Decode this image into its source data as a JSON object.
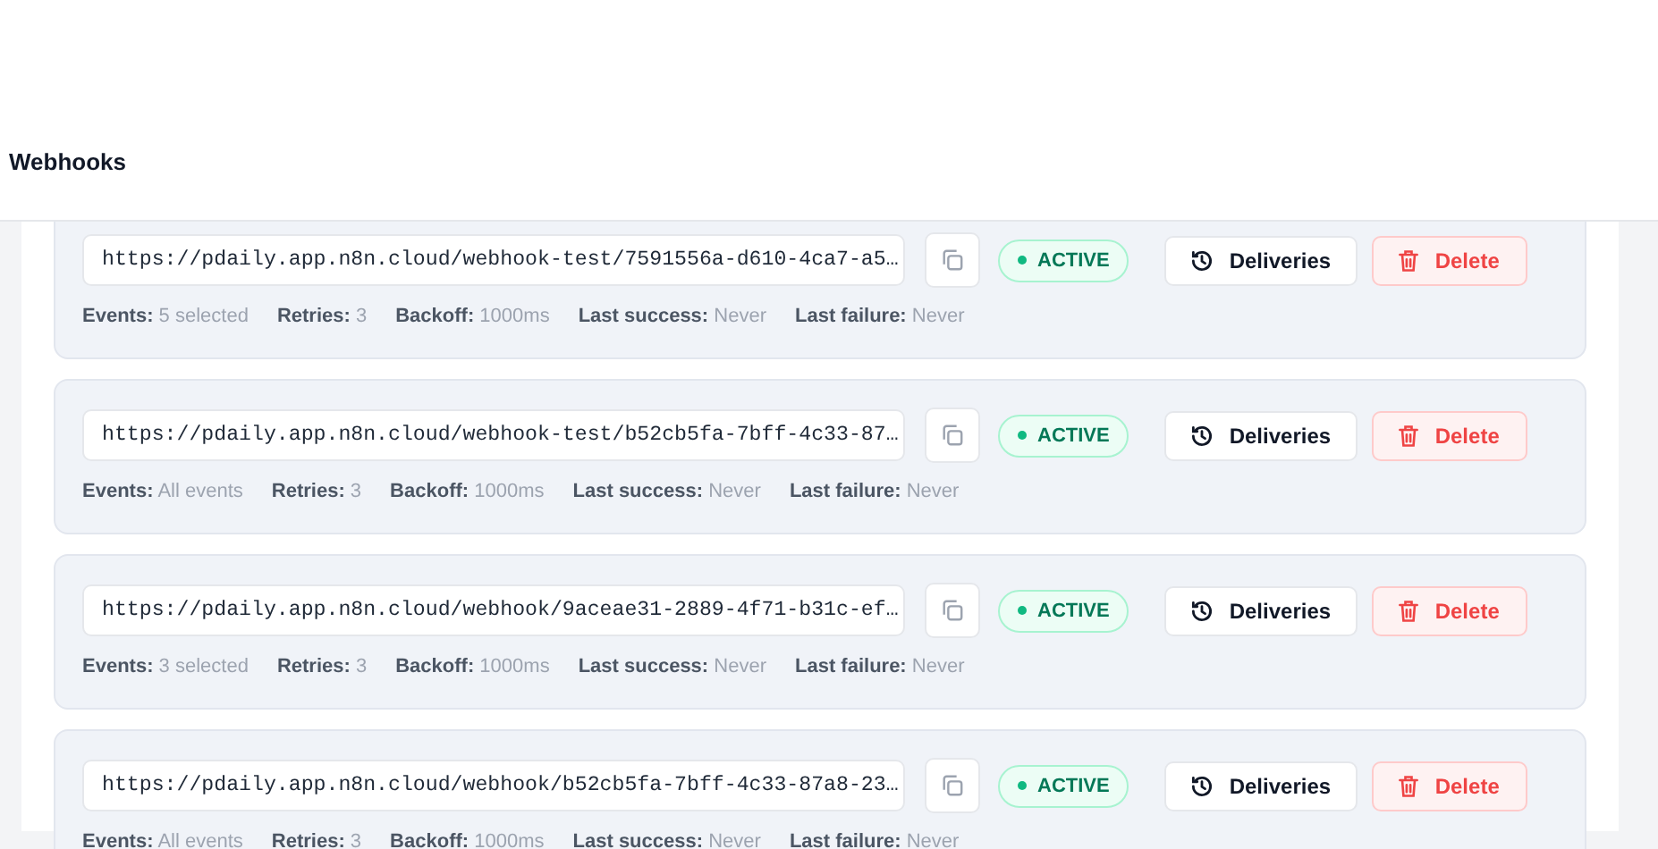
{
  "page_title": "Webhooks",
  "webhooks": [
    {
      "url": "https://pdaily.app.n8n.cloud/webhook-test/7591556a-d610-4ca7-a5…",
      "status": "ACTIVE",
      "actions": [
        "Deliveries",
        "Delete"
      ],
      "meta": [
        {
          "label": "Events:",
          "value": "5 selected"
        },
        {
          "label": "Retries:",
          "value": "3"
        },
        {
          "label": "Backoff:",
          "value": "1000ms"
        },
        {
          "label": "Last success:",
          "value": "Never"
        },
        {
          "label": "Last failure:",
          "value": "Never"
        }
      ]
    },
    {
      "url": "https://pdaily.app.n8n.cloud/webhook-test/b52cb5fa-7bff-4c33-87…",
      "status": "ACTIVE",
      "actions": [
        "Deliveries",
        "Delete"
      ],
      "meta": [
        {
          "label": "Events:",
          "value": "All events"
        },
        {
          "label": "Retries:",
          "value": "3"
        },
        {
          "label": "Backoff:",
          "value": "1000ms"
        },
        {
          "label": "Last success:",
          "value": "Never"
        },
        {
          "label": "Last failure:",
          "value": "Never"
        }
      ]
    },
    {
      "url": "https://pdaily.app.n8n.cloud/webhook/9aceae31-2889-4f71-b31c-ef…",
      "status": "ACTIVE",
      "actions": [
        "Deliveries",
        "Delete"
      ],
      "meta": [
        {
          "label": "Events:",
          "value": "3 selected"
        },
        {
          "label": "Retries:",
          "value": "3"
        },
        {
          "label": "Backoff:",
          "value": "1000ms"
        },
        {
          "label": "Last success:",
          "value": "Never"
        },
        {
          "label": "Last failure:",
          "value": "Never"
        }
      ]
    },
    {
      "url": "https://pdaily.app.n8n.cloud/webhook/b52cb5fa-7bff-4c33-87a8-23…",
      "status": "ACTIVE",
      "actions": [
        "Deliveries",
        "Delete"
      ],
      "meta": [
        {
          "label": "Events:",
          "value": "All events"
        },
        {
          "label": "Retries:",
          "value": "3"
        },
        {
          "label": "Backoff:",
          "value": "1000ms"
        },
        {
          "label": "Last success:",
          "value": "Never"
        },
        {
          "label": "Last failure:",
          "value": "Never"
        }
      ]
    }
  ]
}
